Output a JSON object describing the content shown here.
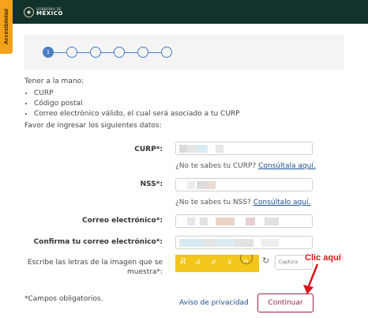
{
  "header": {
    "logo_line1": "GOBIERNO DE",
    "logo_line2": "MÉXICO",
    "accessibility_label": "Accesibilidad"
  },
  "stepper": {
    "steps": [
      "1",
      "",
      "",
      "",
      "",
      ""
    ],
    "active_step": 1
  },
  "intro": {
    "heading": "Tener a la mano:",
    "items": [
      "CURP",
      "Código postal",
      "Correo electrónico válido, el cual será asociado a tu CURP"
    ],
    "instruction": "Favor de ingresar los siguientes datos:"
  },
  "form": {
    "curp": {
      "label": "CURP*:",
      "hint": "¿No te sabes tu CURP?",
      "hint_link": "Consúltala aquí."
    },
    "nss": {
      "label": "NSS*:",
      "hint": "¿No te sabes tu NSS?",
      "hint_link": "Consúltalo aquí."
    },
    "email": {
      "label": "Correo electrónico*:"
    },
    "email_confirm": {
      "label": "Confirma tu correo electrónico*:"
    },
    "captcha": {
      "label": "Escribe las letras de la imagen que se muestra*:",
      "chars": [
        "R",
        "a",
        "e",
        "x",
        "n"
      ],
      "placeholder": "Captura"
    }
  },
  "footer": {
    "required_note": "*Campos obligatorios.",
    "privacy_link": "Aviso de privacidad",
    "continue_label": "Continuar"
  },
  "annotation": {
    "text": "Clic aquí",
    "color": "#d9141a"
  },
  "colors": {
    "header_bg": "#13322b",
    "accent_blue": "#4a7fc1",
    "button_border": "#9d2449",
    "accessibility_tab": "#f4a21b",
    "captcha_bg": "#f2c61b"
  }
}
